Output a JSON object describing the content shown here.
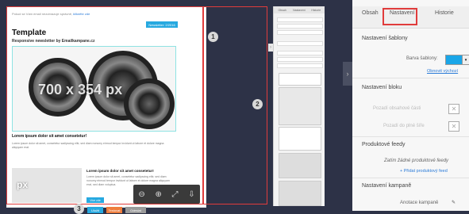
{
  "doc": {
    "header_text": "Pokud se Vám email nezobrazuje správně,",
    "header_link": "klikněte zde",
    "date": "Newsletter: 2/2016",
    "title": "Template",
    "subtitle": "Responsive newsletter by Emailkampane.cz",
    "hero_watermark": "700 x 354 px",
    "article_heading": "Lorem ipsum dolor sit amet consetetur!",
    "article_text": "Lorem ipsum dolor sit amet, consetetur sadipscing elitr, sed diam nonumy eirmod tempor invidunt ut labore et dolore magna aliquyam erat.",
    "side_heading": "Lorem ipsum dolor sit amet consetetur!",
    "side_text": "Lorem ipsum dolor sit amet, consetetur sadipscing elitr, sed diam nonumy eirmod tempor invidunt ut labore et dolore magna aliquyam erat, sed diam voluptua.",
    "side_button": "Více zde",
    "thumb_watermark": "px"
  },
  "toolbar": {
    "zoom_out": "⊖",
    "zoom_in": "⊕",
    "fullscreen": "⤢",
    "save": "⇩"
  },
  "actions": {
    "preview": "Uložit",
    "test": "Testovat",
    "send": "Odeslat"
  },
  "badges": [
    "1",
    "2",
    "3"
  ],
  "small_panel_tabs": [
    "Obsah",
    "Nastavení",
    "Historie"
  ],
  "panel": {
    "tabs": [
      "Obsah",
      "Nastavení",
      "Historie"
    ],
    "section_template": "Nastavení šablony",
    "label_color": "Barva šablony:",
    "link_restore": "Obnovit výchozí",
    "section_block": "Nastavení bloku",
    "label_bg_color": "Pozadí obsahové části",
    "label_bg_full": "Pozadí do plné šíře",
    "section_feeds": "Produktové feedy",
    "no_feeds": "Zatím žádné produktové feedy",
    "add_feed": "+ Přidat produktový feed",
    "section_campaign": "Nastavení kampaně",
    "campaign_annotation": "Anotace kampaně"
  },
  "colors": {
    "template_color": "#1aa6e8",
    "accent_red": "#e03c3c",
    "button_blue": "#27a9e0"
  }
}
